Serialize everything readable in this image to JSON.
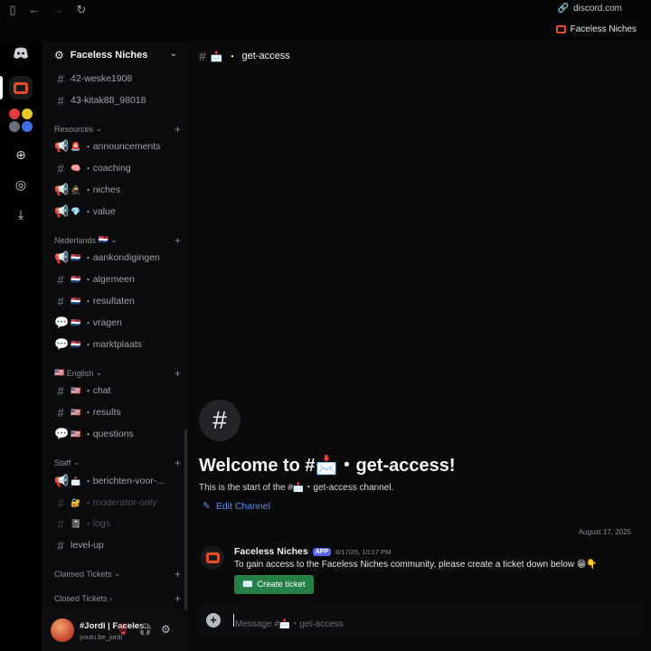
{
  "browser": {
    "url": "discord.com",
    "tab_title": "Faceless Niches"
  },
  "server": {
    "name": "Faceless Niches"
  },
  "channels_top": [
    {
      "name": "42-weske1908"
    },
    {
      "name": "43-kitak88_98018"
    }
  ],
  "categories": {
    "resources": "Resources",
    "nederlands": "Nederlands",
    "english": "English",
    "staff": "Staff",
    "claimed": "Claimed Tickets",
    "closed": "Closed Tickets"
  },
  "resources_channels": [
    {
      "emoji": "🚨",
      "name": "announcements"
    },
    {
      "emoji": "🧠",
      "name": "coaching"
    },
    {
      "emoji": "🥷",
      "name": "niches"
    },
    {
      "emoji": "💎",
      "name": "value"
    }
  ],
  "nl_channels": [
    {
      "emoji": "🇳🇱",
      "name": "aankondigingen"
    },
    {
      "emoji": "🇳🇱",
      "name": "algemeen"
    },
    {
      "emoji": "🇳🇱",
      "name": "resultaten"
    },
    {
      "emoji": "🇳🇱",
      "name": "vragen"
    },
    {
      "emoji": "🇳🇱",
      "name": "marktplaats"
    }
  ],
  "en_channels": [
    {
      "emoji": "🇺🇸",
      "name": "chat"
    },
    {
      "emoji": "🇺🇸",
      "name": "results"
    },
    {
      "emoji": "🇺🇸",
      "name": "questions"
    }
  ],
  "staff_channels": [
    {
      "emoji": "📩",
      "name": "berichten-voor-..."
    },
    {
      "emoji": "🔐",
      "name": "moderator-only"
    },
    {
      "emoji": "📓",
      "name": "logs"
    },
    {
      "emoji": "",
      "name": "level-up"
    }
  ],
  "user": {
    "name": "#Jordi | Faceles...",
    "status": "youtu.be_jordi"
  },
  "main": {
    "channel_emoji": "📩",
    "channel_name": "get-access",
    "welcome_title": "Welcome to #📩・get-access!",
    "welcome_sub": "This is the start of the #📩・get-access channel.",
    "edit_channel": "Edit Channel",
    "date_divider": "August 17, 2025",
    "message": {
      "author": "Faceless Niches",
      "tag": "APP",
      "time": "8/17/25, 10:17 PM",
      "text": "To gain access to the Faceless Niches community, please create a ticket down below 😁👇",
      "button": "Create ticket"
    },
    "composer_placeholder": "Message #📩・get-access"
  }
}
